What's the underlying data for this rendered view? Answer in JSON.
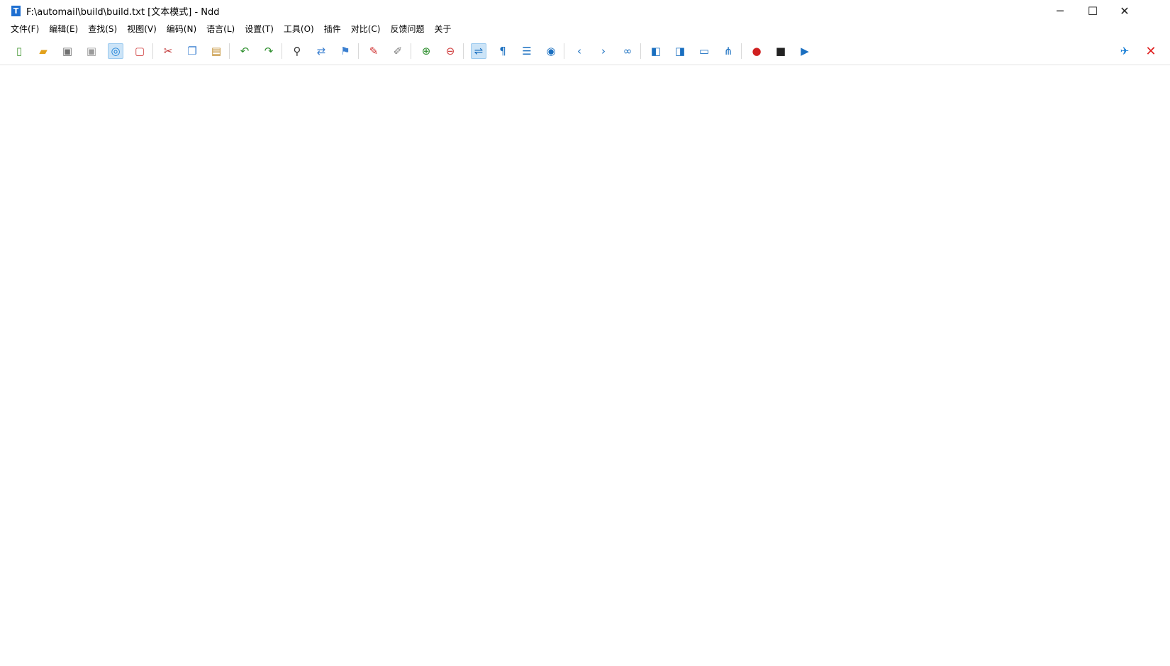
{
  "window": {
    "title": "F:\\automail\\build\\build.txt [文本模式] - Ndd",
    "minimize": "─",
    "maximize": "☐",
    "close": "✕"
  },
  "menu": [
    "文件(F)",
    "编辑(E)",
    "查找(S)",
    "视图(V)",
    "编码(N)",
    "语言(L)",
    "设置(T)",
    "工具(O)",
    "插件",
    "对比(C)",
    "反馈问题",
    "关于"
  ],
  "toolbar_icons": [
    {
      "name": "new-file-icon",
      "glyph": "▯",
      "color": "#4a9a3a"
    },
    {
      "name": "open-file-icon",
      "glyph": "▰",
      "color": "#e2a11b"
    },
    {
      "name": "save-icon",
      "glyph": "▣",
      "color": "#707070"
    },
    {
      "name": "save-all-icon",
      "glyph": "▣",
      "color": "#9a9a9a"
    },
    {
      "name": "auto-save-icon",
      "glyph": "◎",
      "color": "#1a7fd6"
    },
    {
      "name": "close-file-icon",
      "glyph": "▢",
      "color": "#d04040"
    },
    {
      "name": "cut-icon",
      "glyph": "✂",
      "color": "#c03030"
    },
    {
      "name": "copy-icon",
      "glyph": "❐",
      "color": "#3a7fd0"
    },
    {
      "name": "paste-icon",
      "glyph": "▤",
      "color": "#c08a2a"
    },
    {
      "name": "undo-icon",
      "glyph": "↶",
      "color": "#2f8f2f"
    },
    {
      "name": "redo-icon",
      "glyph": "↷",
      "color": "#2f8f2f"
    },
    {
      "name": "find-icon",
      "glyph": "⚲",
      "color": "#333333"
    },
    {
      "name": "replace-icon",
      "glyph": "⇄",
      "color": "#3a7fd0"
    },
    {
      "name": "bookmark-icon",
      "glyph": "⚑",
      "color": "#3a7fd0"
    },
    {
      "name": "mark-icon",
      "glyph": "✎",
      "color": "#d03030"
    },
    {
      "name": "clear-mark-icon",
      "glyph": "✐",
      "color": "#7a7a7a"
    },
    {
      "name": "zoom-in-icon",
      "glyph": "⊕",
      "color": "#2f8f2f"
    },
    {
      "name": "zoom-out-icon",
      "glyph": "⊖",
      "color": "#d04040"
    },
    {
      "name": "word-wrap-icon",
      "glyph": "⇌",
      "color": "#1a6fc0"
    },
    {
      "name": "show-symbols-icon",
      "glyph": "¶",
      "color": "#1a6fc0"
    },
    {
      "name": "indent-guide-icon",
      "glyph": "☰",
      "color": "#1a6fc0"
    },
    {
      "name": "show-all-icon",
      "glyph": "◉",
      "color": "#1a6fc0"
    },
    {
      "name": "previous-icon",
      "glyph": "‹",
      "color": "#1a6fc0"
    },
    {
      "name": "next-icon",
      "glyph": "›",
      "color": "#1a6fc0"
    },
    {
      "name": "goto-icon",
      "glyph": "∞",
      "color": "#1a6fc0"
    },
    {
      "name": "compare-file-icon",
      "glyph": "◧",
      "color": "#1a6fc0"
    },
    {
      "name": "compare-dir-icon",
      "glyph": "◨",
      "color": "#1a6fc0"
    },
    {
      "name": "bin-compare-icon",
      "glyph": "▭",
      "color": "#1a6fc0"
    },
    {
      "name": "file-tree-icon",
      "glyph": "⋔",
      "color": "#1a6fc0"
    },
    {
      "name": "record-macro-icon",
      "glyph": "●",
      "color": "#d02020"
    },
    {
      "name": "stop-macro-icon",
      "glyph": "■",
      "color": "#222222"
    },
    {
      "name": "play-macro-icon",
      "glyph": "▶",
      "color": "#1a6fc0"
    }
  ],
  "toolbar_right": {
    "pin_glyph": "✈",
    "exit_glyph": "✕"
  }
}
